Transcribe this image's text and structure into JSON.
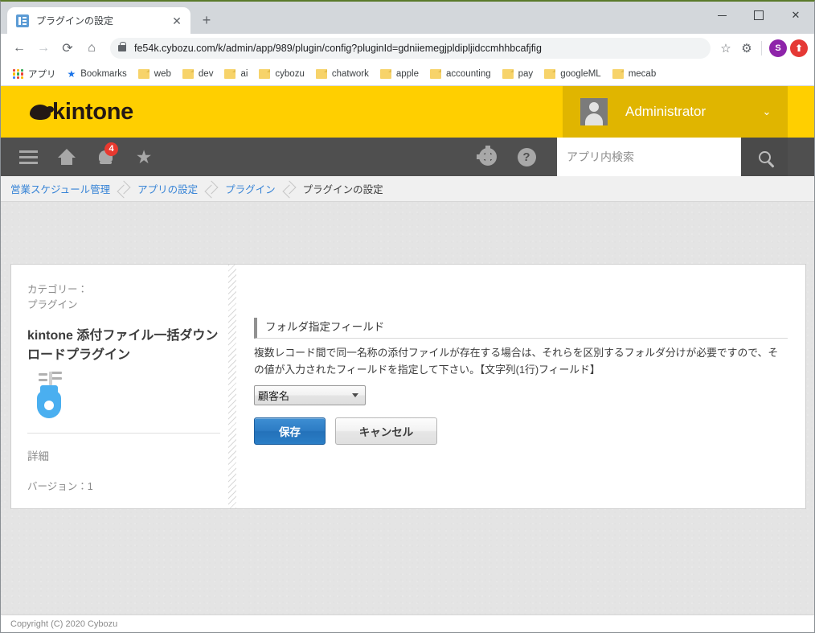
{
  "browser": {
    "tab": {
      "title": "プラグインの設定",
      "favicon": "kintone-app-icon",
      "close_label": "✕"
    },
    "new_tab_label": "+",
    "window_controls": {
      "minimize": "minimize-icon",
      "maximize": "maximize-icon",
      "close": "✕"
    },
    "nav": {
      "back": "←",
      "forward": "→",
      "reload": "⟳",
      "home": "⌂"
    },
    "omnibox": {
      "url": "fe54k.cybozu.com/k/admin/app/989/plugin/config?pluginId=gdniiemegjpldipljidccmhhbcafjfig",
      "lock_icon": "lock-icon",
      "bookmark_star": "☆"
    },
    "extensions": [
      {
        "name": "gear-extension",
        "glyph": "⚙",
        "color": "#5f6368"
      },
      {
        "name": "s-extension",
        "glyph": "S",
        "color": "#8e24aa"
      },
      {
        "name": "arrow-extension",
        "glyph": "⬆",
        "color": "#e53935"
      }
    ],
    "bookmarks": [
      {
        "label": "アプリ",
        "icon": "apps-grid-icon"
      },
      {
        "label": "Bookmarks",
        "icon": "star-icon"
      },
      {
        "label": "web",
        "icon": "folder-icon"
      },
      {
        "label": "dev",
        "icon": "folder-icon"
      },
      {
        "label": "ai",
        "icon": "folder-icon"
      },
      {
        "label": "cybozu",
        "icon": "folder-icon"
      },
      {
        "label": "chatwork",
        "icon": "folder-icon"
      },
      {
        "label": "apple",
        "icon": "folder-icon"
      },
      {
        "label": "accounting",
        "icon": "folder-icon"
      },
      {
        "label": "pay",
        "icon": "folder-icon"
      },
      {
        "label": "googleML",
        "icon": "folder-icon"
      },
      {
        "label": "mecab",
        "icon": "folder-icon"
      }
    ]
  },
  "kintone": {
    "brand": "kintone",
    "brand_color": "#ffcf00",
    "user": {
      "name": "Administrator",
      "caret": "⌄"
    },
    "navbar": {
      "menu_icon": "hamburger-icon",
      "home_icon": "home-icon",
      "notification_icon": "bell-icon",
      "notification_count": "4",
      "favorite_icon": "star-icon",
      "settings_icon": "gear-icon",
      "help_icon": "help-icon",
      "help_glyph": "?",
      "search_placeholder": "アプリ内検索",
      "search_value": "",
      "search_icon": "search-icon"
    },
    "breadcrumb": [
      {
        "label": "営業スケジュール管理",
        "current": false
      },
      {
        "label": "アプリの設定",
        "current": false
      },
      {
        "label": "プラグイン",
        "current": false
      },
      {
        "label": "プラグインの設定",
        "current": true
      }
    ],
    "plugin": {
      "category_label": "カテゴリー：",
      "category_value": "プラグイン",
      "name": "kintone 添付ファイル一括ダウンロードプラグイン",
      "icon": "zipper-icon",
      "detail_label": "詳細",
      "version": "バージョン：1"
    },
    "form": {
      "field_title": "フォルダ指定フィールド",
      "description": "複数レコード間で同一名称の添付ファイルが存在する場合は、それらを区別するフォルダ分けが必要ですので、その値が入力されたフィールドを指定して下さい。【文字列(1行)フィールド】",
      "select": {
        "value": "顧客名",
        "caret": "▼"
      },
      "save_label": "保存",
      "cancel_label": "キャンセル"
    },
    "footer": "Copyright (C) 2020 Cybozu"
  }
}
